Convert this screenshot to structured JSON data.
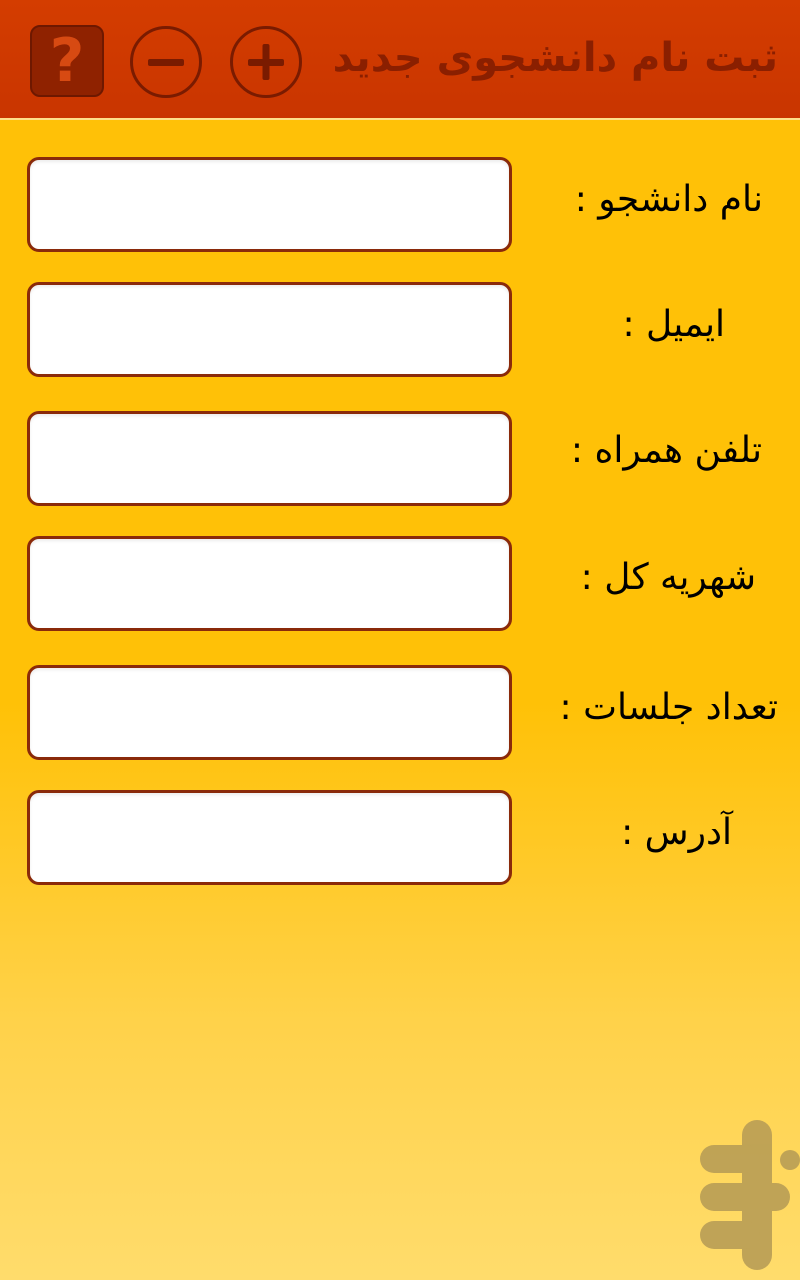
{
  "header": {
    "title": "ثبت نام دانشجوی جدید",
    "help_label": "?",
    "colors": {
      "bar": "#cf3a00",
      "icons": "#7a1b00"
    }
  },
  "form": {
    "fields": [
      {
        "label": "نام دانشجو :",
        "value": "",
        "placeholder": ""
      },
      {
        "label": "ایمیل :",
        "value": "",
        "placeholder": ""
      },
      {
        "label": "تلفن همراه :",
        "value": "",
        "placeholder": ""
      },
      {
        "label": "شهریه کل :",
        "value": "",
        "placeholder": ""
      },
      {
        "label": "تعداد جلسات :",
        "value": "",
        "placeholder": ""
      },
      {
        "label": "آدرس :",
        "value": "",
        "placeholder": ""
      }
    ]
  },
  "colors": {
    "background": "#ffc107",
    "field_border": "#8a2a0a",
    "watermark": "#b59a55"
  },
  "icons": {
    "help": "question-mark-icon",
    "remove": "minus-circle-icon",
    "add": "plus-circle-icon",
    "watermark": "bazaar-logo-icon"
  }
}
